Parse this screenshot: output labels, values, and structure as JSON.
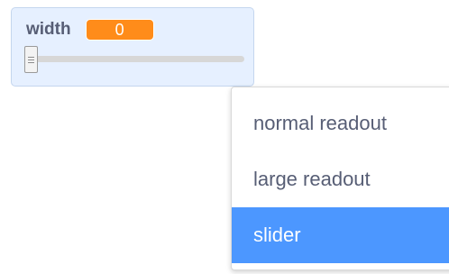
{
  "monitor": {
    "label": "width",
    "value": "0",
    "slider": {
      "value": 0,
      "min": 0,
      "max": 100
    }
  },
  "context_menu": {
    "items": [
      {
        "label": "normal readout",
        "selected": false
      },
      {
        "label": "large readout",
        "selected": false
      },
      {
        "label": "slider",
        "selected": true
      }
    ]
  },
  "colors": {
    "monitor_bg": "#e6f0ff",
    "value_badge": "#ff8c1a",
    "menu_highlight": "#4c97ff",
    "menu_text": "#575e75"
  },
  "icons": {
    "slider_thumb": "slider-thumb-grip-icon"
  }
}
